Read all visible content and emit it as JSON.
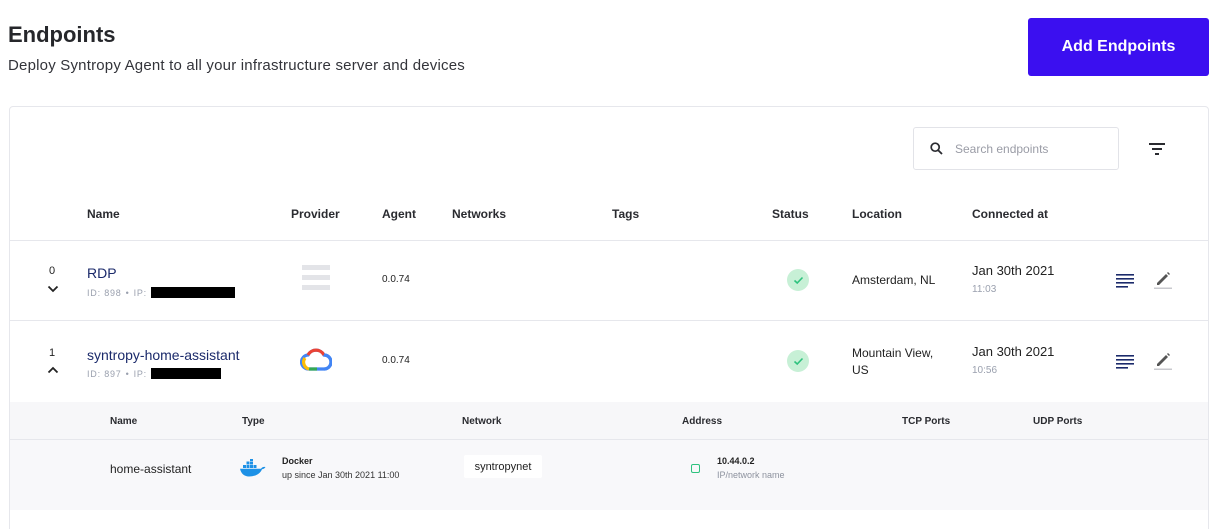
{
  "header": {
    "title": "Endpoints",
    "subtitle": "Deploy Syntropy Agent to all your infrastructure server and devices",
    "add_button": "Add Endpoints"
  },
  "search": {
    "placeholder": "Search endpoints",
    "icon": "search-icon"
  },
  "filter": {
    "icon": "filter-icon"
  },
  "colors": {
    "accent": "#3b0ff0",
    "status_ok_bg": "#c7f0d6",
    "status_ok": "#2ec27e",
    "name_link": "#1b2a6b"
  },
  "columns": [
    "Name",
    "Provider",
    "Agent",
    "Networks",
    "Tags",
    "Status",
    "Location",
    "Connected at"
  ],
  "endpoints": [
    {
      "index": "0",
      "expanded": false,
      "name": "RDP",
      "id_label": "ID: 898",
      "ip_label": "IP:",
      "provider_icon": "generic-server-icon",
      "agent": "0.0.74",
      "status": "connected",
      "location": "Amsterdam, NL",
      "date": "Jan 30th 2021",
      "time": "11:03"
    },
    {
      "index": "1",
      "expanded": true,
      "name": "syntropy-home-assistant",
      "id_label": "ID: 897",
      "ip_label": "IP:",
      "provider_icon": "google-cloud-icon",
      "agent": "0.0.74",
      "status": "connected",
      "location_line1": "Mountain View,",
      "location_line2": "US",
      "date": "Jan 30th 2021",
      "time": "10:56"
    }
  ],
  "services": {
    "columns": [
      "Name",
      "Type",
      "Network",
      "Address",
      "TCP Ports",
      "UDP Ports"
    ],
    "rows": [
      {
        "name": "home-assistant",
        "type_icon": "docker-icon",
        "type": "Docker",
        "type_detail": "up since Jan 30th 2021 11:00",
        "network": "syntropynet",
        "address": "10.44.0.2",
        "address_detail": "IP/network name",
        "tcp_ports": "",
        "udp_ports": ""
      }
    ]
  }
}
